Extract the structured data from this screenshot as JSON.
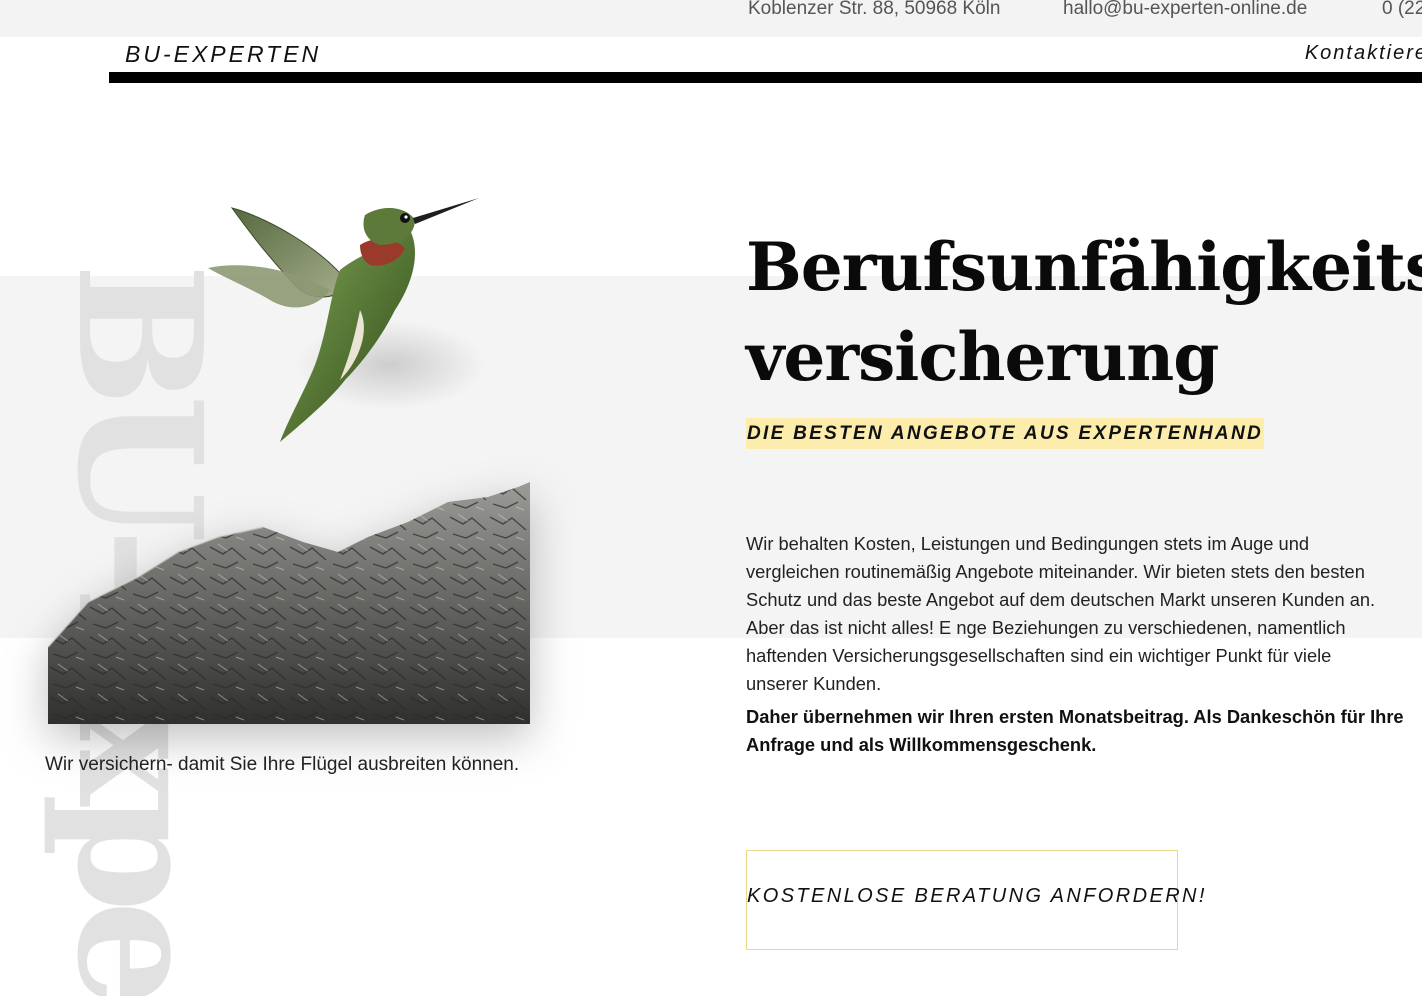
{
  "topbar": {
    "address": "Koblenzer Str. 88, 50968 Köln",
    "email": "hallo@bu-experten-online.de",
    "phone": "0 (22"
  },
  "nav": {
    "logo": "BU-EXPERTEN",
    "contact": "Kontaktiere"
  },
  "watermark": "BU-Expe",
  "hero": {
    "caption": "Wir versichern- damit Sie Ihre Flügel ausbreiten können.",
    "headline_line1": "Berufsunfähigkeits-",
    "headline_line2": "versicherung",
    "tagline": "DIE BESTEN ANGEBOTE AUS EXPERTENHAND",
    "body": "Wir behalten Kosten, Leistungen und Bedingungen stets im Auge und vergleichen routinemäßig Angebote miteinander. Wir bieten stets den besten Schutz und das beste Angebot auf dem deutschen Markt unseren Kunden an. Aber das ist nicht alles! E nge Beziehungen zu verschiedenen, namentlich haftenden Versicherungsgesellschaften sind ein wichtiger Punkt für viele unserer Kunden.",
    "body_strong": "Daher übernehmen wir Ihren ersten Monatsbeitrag. Als Dankeschön für Ihre Anfrage und als Willkommensgeschenk.",
    "cta": "KOSTENLOSE BERATUNG ANFORDERN!"
  },
  "colors": {
    "tagline_highlight": "#fcedad",
    "band": "#f4f4f4",
    "rule": "#000000"
  },
  "icons": {
    "bird": "hummingbird-image",
    "rock": "rock-mountain-image"
  }
}
